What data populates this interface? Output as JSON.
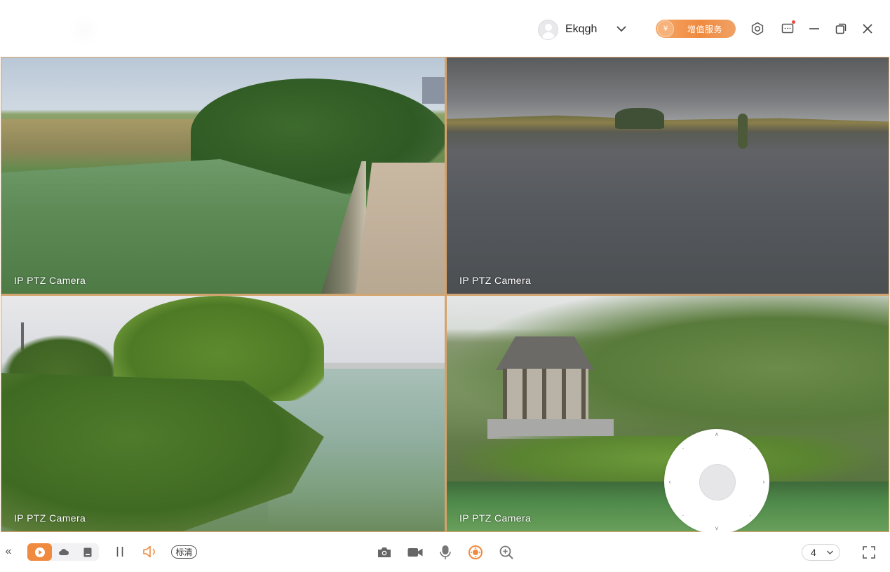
{
  "header": {
    "username": "Ekqgh",
    "value_added_label": "增值服务",
    "coin_symbol": "¥",
    "has_notification": true
  },
  "tiles": [
    {
      "label": "IP PTZ Camera"
    },
    {
      "label": "IP PTZ Camera"
    },
    {
      "label": "IP PTZ Camera"
    },
    {
      "label": "IP PTZ Camera"
    }
  ],
  "toolbar": {
    "collapse_glyph": "«",
    "quality_label": "标清",
    "split_count": "4",
    "active_mode": "live"
  },
  "colors": {
    "accent": "#f08a3f",
    "tile_border": "#d6a36b",
    "icon": "#555555"
  }
}
